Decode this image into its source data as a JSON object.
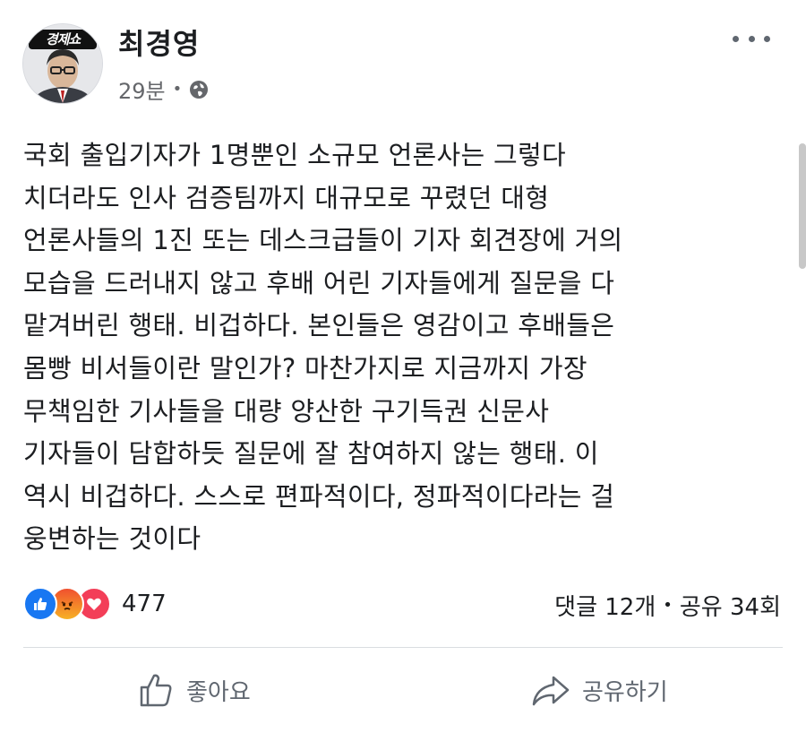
{
  "author": {
    "name": "최경영",
    "avatar_badge": "경제쇼"
  },
  "meta": {
    "time": "29분",
    "separator": "•",
    "privacy_icon": "globe-icon"
  },
  "post": {
    "lines": [
      "국회 출입기자가 1명뿐인 소규모 언론사는 그렇다",
      "치더라도 인사 검증팀까지 대규모로 꾸렸던 대형",
      "언론사들의 1진 또는 데스크급들이 기자 회견장에 거의",
      "모습을 드러내지 않고 후배 어린 기자들에게 질문을 다",
      "맡겨버린 행태. 비겁하다. 본인들은 영감이고 후배들은",
      "몸빵 비서들이란 말인가? 마찬가지로 지금까지 가장",
      "무책임한 기사들을 대량 양산한 구기득권 신문사",
      "기자들이 담합하듯 질문에 잘 참여하지 않는 행태. 이",
      "역시 비겁하다. 스스로 편파적이다, 정파적이다라는 걸",
      "웅변하는 것이다"
    ]
  },
  "reactions": {
    "icons": [
      "like-icon",
      "angry-icon",
      "love-icon"
    ],
    "count": "477"
  },
  "stats": {
    "comments": "댓글 12개",
    "separator": "•",
    "shares": "공유 34회"
  },
  "actions": {
    "like_label": "좋아요",
    "share_label": "공유하기"
  },
  "colors": {
    "like_blue": "#1877f2",
    "love_red": "#f33e58",
    "text": "#1c1e21",
    "muted": "#65676b"
  }
}
